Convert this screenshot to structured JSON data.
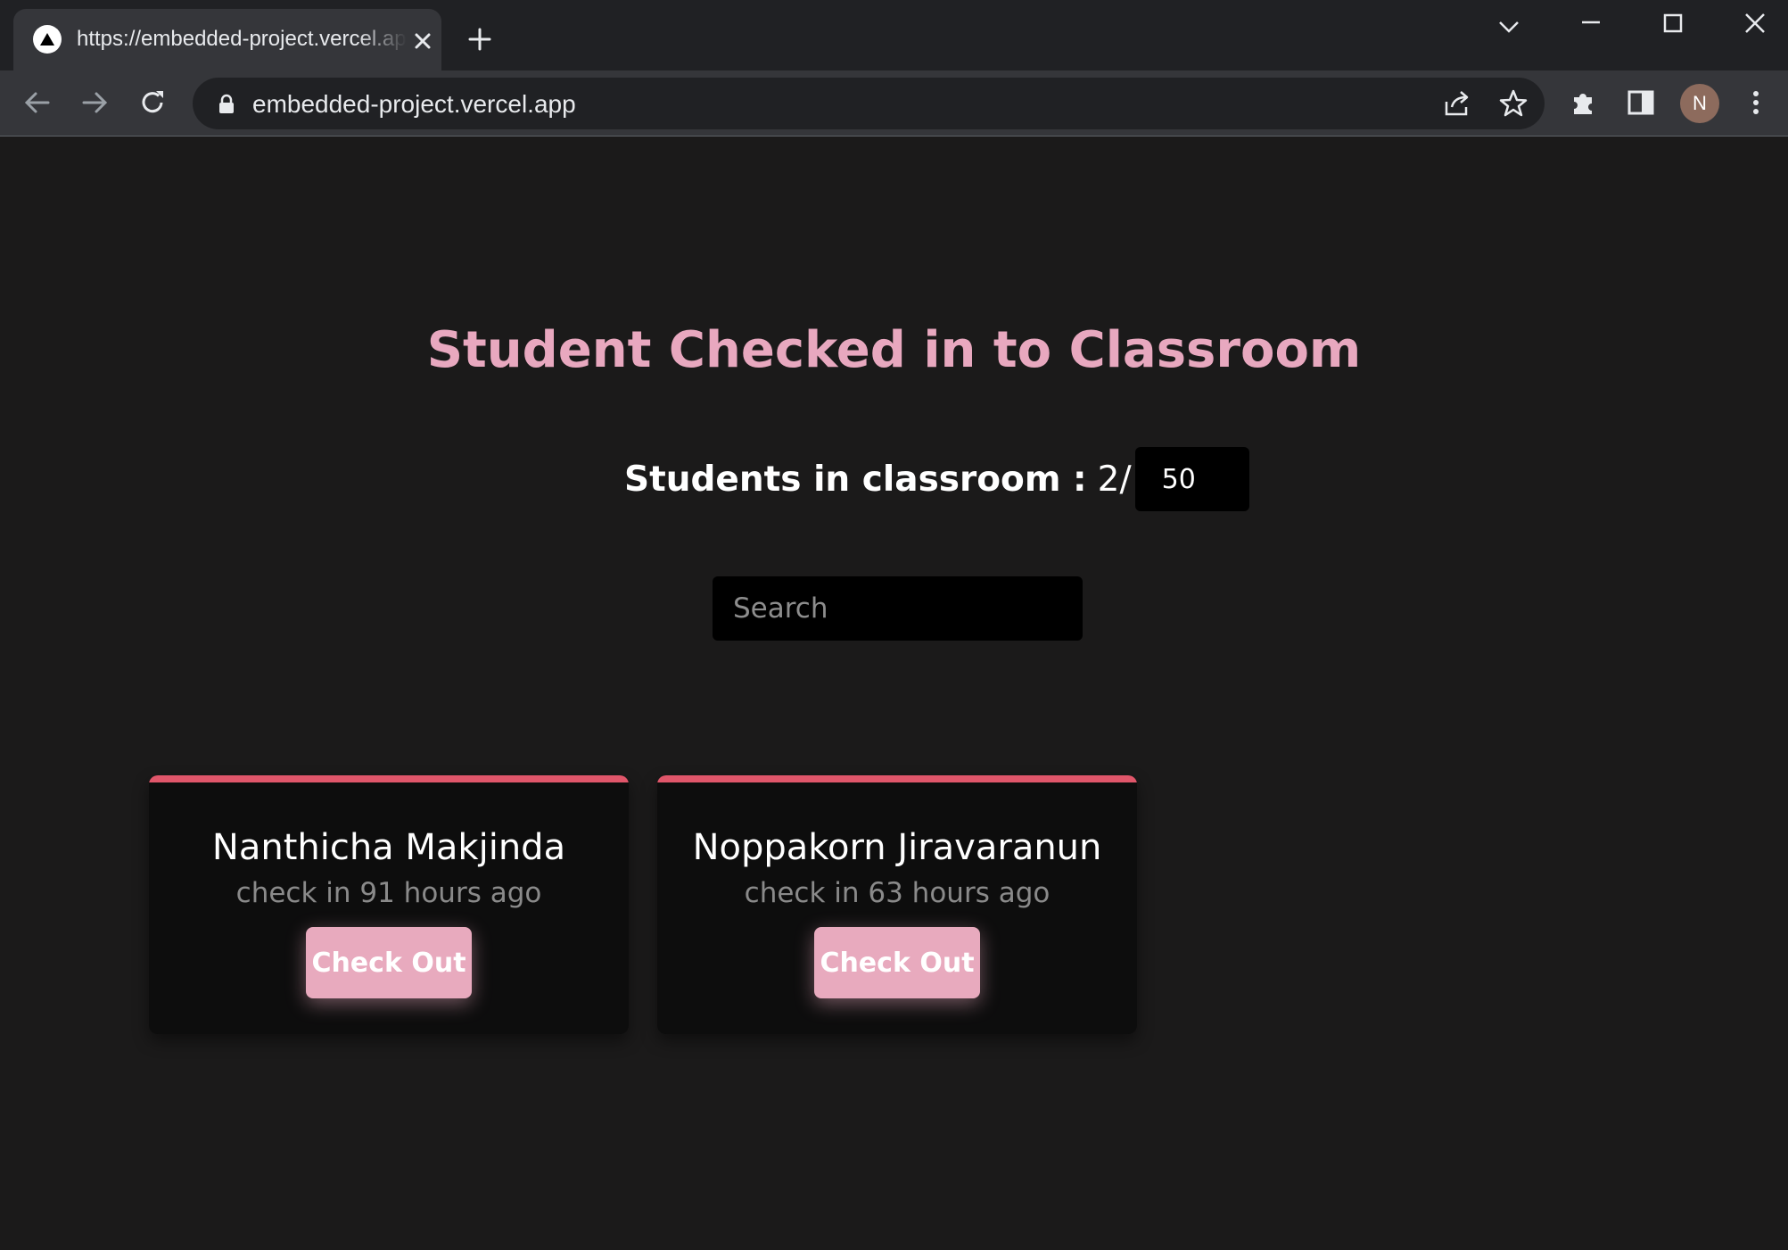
{
  "browser": {
    "tab_title": "https://embedded-project.vercel.app",
    "url": "embedded-project.vercel.app",
    "profile_initial": "N",
    "icons": [
      "vercel-favicon-icon",
      "close-icon",
      "new-tab-icon",
      "tab-search-chevron-icon",
      "minimize-icon",
      "maximize-icon",
      "window-close-icon",
      "back-icon",
      "forward-icon",
      "reload-icon",
      "lock-icon",
      "share-icon",
      "bookmark-star-icon",
      "extensions-icon",
      "side-panel-icon",
      "kebab-menu-icon"
    ]
  },
  "page": {
    "title": "Student Checked in to Classroom",
    "count_label": "Students in classroom :",
    "count_value": "2",
    "count_separator": "/",
    "max_value": "50",
    "search_placeholder": "Search",
    "accent_color": "#e8a8bf",
    "card_bar_color": "#e0566a",
    "students": [
      {
        "name": "Nanthicha Makjinda",
        "time": "check in 91 hours ago",
        "button": "Check Out"
      },
      {
        "name": "Noppakorn Jiravaranun",
        "time": "check in 63 hours ago",
        "button": "Check Out"
      }
    ]
  }
}
